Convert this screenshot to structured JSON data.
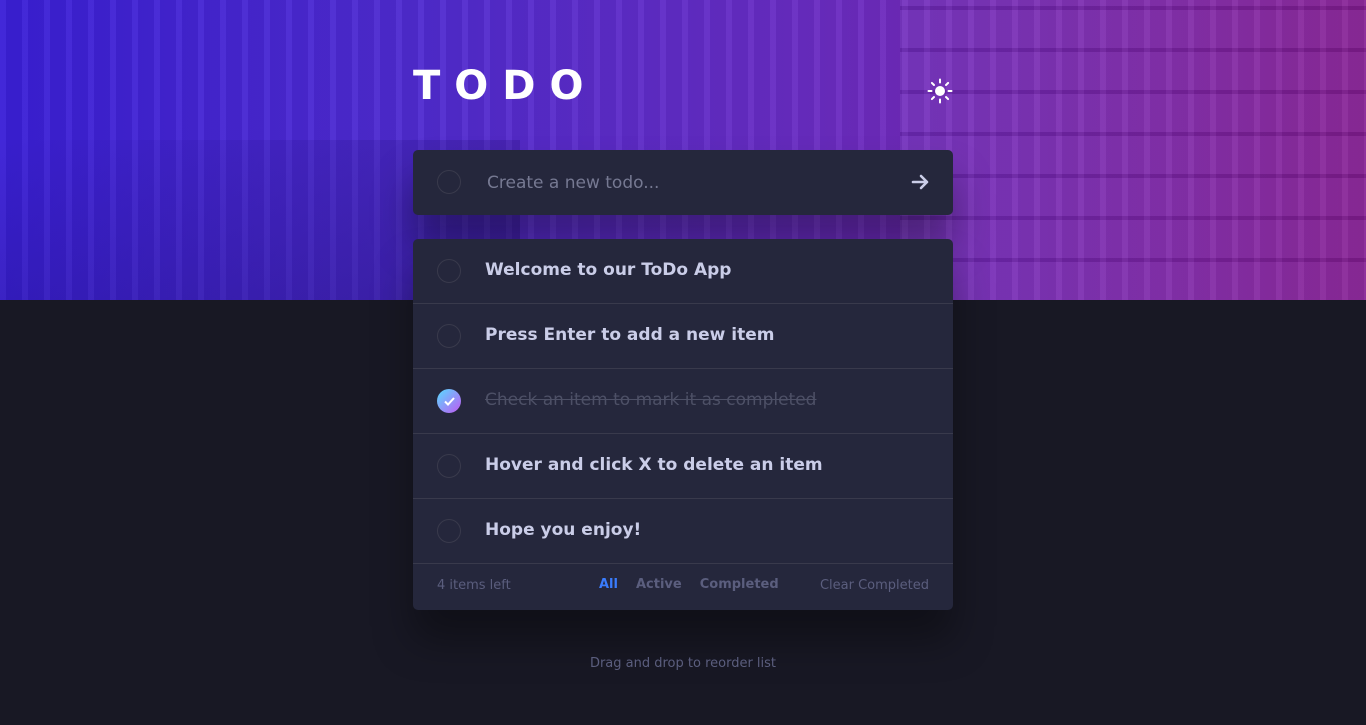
{
  "app": {
    "title": "TODO"
  },
  "new_todo": {
    "placeholder": "Create a new todo..."
  },
  "todos": [
    {
      "text": "Welcome to our ToDo App",
      "completed": false
    },
    {
      "text": "Press Enter to add a new item",
      "completed": false
    },
    {
      "text": "Check an item to mark it as completed",
      "completed": true
    },
    {
      "text": "Hover and click X to delete an item",
      "completed": false
    },
    {
      "text": "Hope you enjoy!",
      "completed": false
    }
  ],
  "footer": {
    "items_left": "4 items left",
    "filters": [
      "All",
      "Active",
      "Completed"
    ],
    "active_filter": "All",
    "clear_label": "Clear Completed"
  },
  "hint": "Drag and drop to reorder list",
  "icons": {
    "theme": "sun-icon",
    "submit": "arrow-right-icon",
    "check": "check-icon"
  },
  "colors": {
    "accent": "#3a7cfd",
    "card": "#25273c",
    "background": "#181824",
    "check_gradient_start": "#57ddff",
    "check_gradient_end": "#c058f3"
  }
}
